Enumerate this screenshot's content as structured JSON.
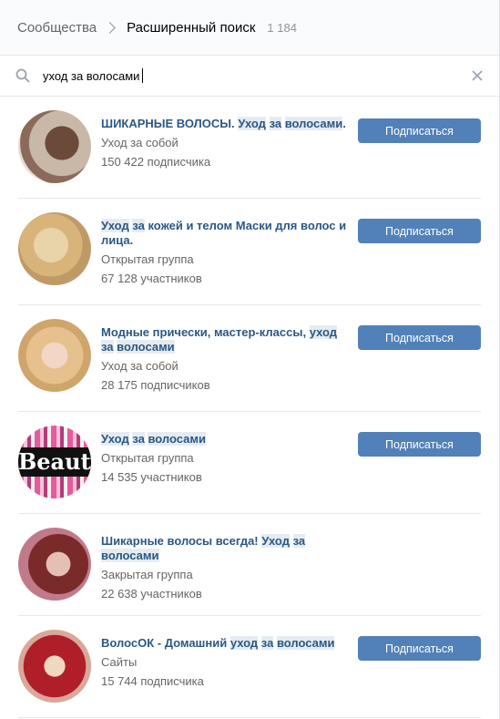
{
  "header": {
    "breadcrumb_root": "Сообщества",
    "breadcrumb_current": "Расширенный поиск",
    "count": "1 184"
  },
  "search": {
    "value": "уход за волосами",
    "icon": "search-icon",
    "clear_icon": "close-icon"
  },
  "subscribe_label": "Подписаться",
  "colors": {
    "accent": "#5181b8",
    "link": "#2a5885",
    "highlight": "#e5ebf1"
  },
  "communities": [
    {
      "title_parts": [
        "ШИКАРНЫЕ ВОЛОСЫ. ",
        "Уход",
        " ",
        "за",
        " ",
        "волосами",
        "."
      ],
      "type": "Уход за собой",
      "members": "150 422 подписчика",
      "has_button": true
    },
    {
      "title_parts": [
        "",
        "Уход",
        " ",
        "за",
        " кожей и телом Маски для волос и лица."
      ],
      "type": "Открытая группа",
      "members": "67 128 участников",
      "has_button": true
    },
    {
      "title_parts": [
        "Модные прически, мастер-классы, ",
        "уход",
        " ",
        "за",
        " ",
        "волосами"
      ],
      "type": "Уход за собой",
      "members": "28 175 подписчиков",
      "has_button": true
    },
    {
      "title_parts": [
        "",
        "Уход",
        " ",
        "за",
        " ",
        "волосами"
      ],
      "type": "Открытая группа",
      "members": "14 535 участников",
      "has_button": true,
      "avatar_text": "Beauty"
    },
    {
      "title_parts": [
        "Шикарные волосы всегда! ",
        "Уход",
        " ",
        "за",
        " ",
        "волосами"
      ],
      "type": "Закрытая группа",
      "members": "22 638 участников",
      "has_button": false
    },
    {
      "title_parts": [
        "ВолосОК - Домашний ",
        "уход",
        " ",
        "за",
        " ",
        "волосами"
      ],
      "type": "Сайты",
      "members": "15 744 подписчика",
      "has_button": true
    }
  ]
}
